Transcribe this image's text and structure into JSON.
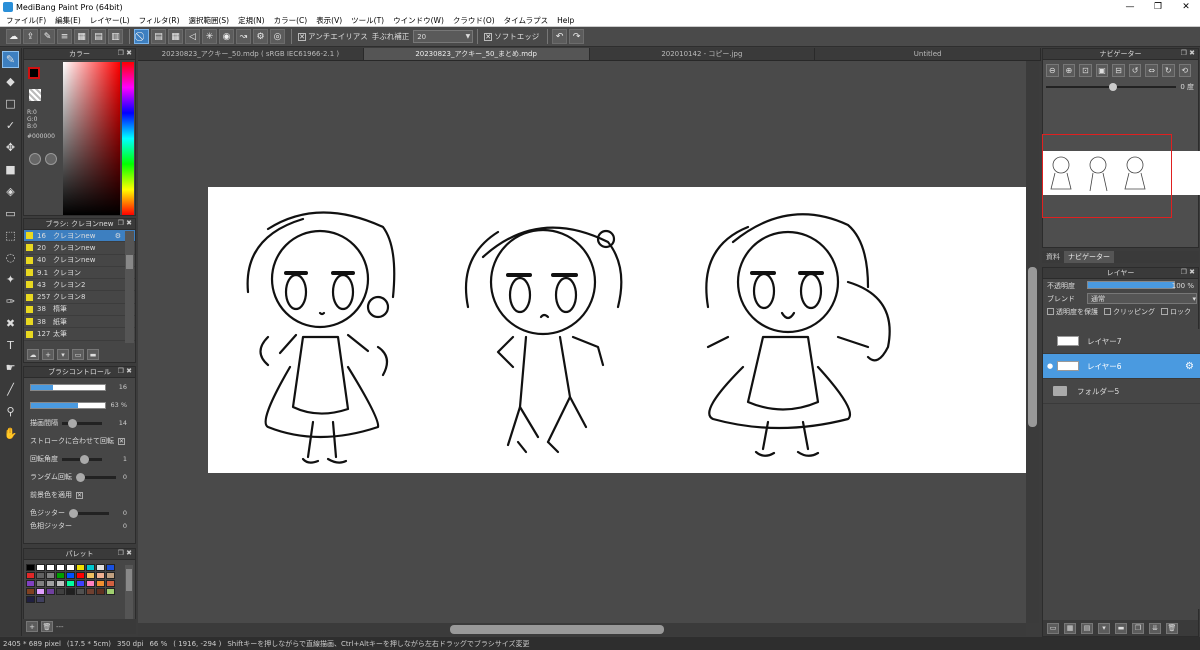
{
  "window": {
    "title": "MediBang Paint Pro (64bit)",
    "minimize": "—",
    "maximize": "❐",
    "close": "✕"
  },
  "menu": [
    "ファイル(F)",
    "編集(E)",
    "レイヤー(L)",
    "フィルタ(R)",
    "選択範囲(S)",
    "定規(N)",
    "カラー(C)",
    "表示(V)",
    "ツール(T)",
    "ウインドウ(W)",
    "クラウド(O)",
    "タイムラプス",
    "Help"
  ],
  "toolbar": {
    "antialias_label": "アンチエイリアス",
    "stabilizer_label": "手ぶれ補正",
    "stabilizer_value": "20",
    "soft_edge_label": "ソフトエッジ"
  },
  "color_panel": {
    "title": "カラー",
    "r": "R:0",
    "g": "G:0",
    "b": "B:0",
    "hex": "#000000"
  },
  "brush_panel": {
    "title": "ブラシ: クレヨンnew",
    "items": [
      {
        "size": "16",
        "name": "クレヨンnew"
      },
      {
        "size": "20",
        "name": "クレヨンnew"
      },
      {
        "size": "40",
        "name": "クレヨンnew"
      },
      {
        "size": "9.1",
        "name": "クレヨン"
      },
      {
        "size": "43",
        "name": "クレヨン2"
      },
      {
        "size": "257",
        "name": "クレヨン8"
      },
      {
        "size": "38",
        "name": "楕筆"
      },
      {
        "size": "38",
        "name": "紙筆"
      },
      {
        "size": "127",
        "name": "太筆"
      }
    ]
  },
  "brush_control": {
    "title": "ブラシコントロール",
    "size_value": "16",
    "opacity_value": "63 %",
    "spacing_label": "描画間隔",
    "spacing_value": "14",
    "rotate_with_stroke_label": "ストロークに合わせて回転",
    "rotation_label": "回転角度",
    "rotation_value": "1",
    "random_rotation_label": "ランダム回転",
    "random_rotation_value": "0",
    "apply_fg_label": "前景色を適用",
    "color_jitter_label": "色ジッター",
    "color_jitter_value": "0",
    "hue_jitter_label": "色相ジッター",
    "hue_jitter_value": "0"
  },
  "palette": {
    "title": "パレット",
    "colors": [
      "#000000",
      "#ffffff",
      "#ffffff",
      "#ffffff",
      "#ffffff",
      "#f0e000",
      "#00c8d0",
      "#e0e0e0",
      "#1850e0",
      "#e02828",
      "#606060",
      "#808080",
      "#00a000",
      "#0050ff",
      "#ff0000",
      "#f0c060",
      "#f0b090",
      "#c0a080",
      "#8040c0",
      "#808080",
      "#a0a0a0",
      "#c0c0c0",
      "#00ffa0",
      "#4040ff",
      "#ff80c0",
      "#f09030",
      "#d06040",
      "#804020",
      "#e0a0ff",
      "#7040a0",
      "#404040",
      "#202020",
      "#505050",
      "#704030",
      "#603020",
      "#a0d070",
      "#202040",
      "#404060"
    ],
    "footer_text": "---"
  },
  "tabs": [
    {
      "label": "20230823_アクキー_50.mdp ( sRGB IEC61966-2.1 )"
    },
    {
      "label": "20230823_アクキー_50_まとめ.mdp"
    },
    {
      "label": "202010142 - コピー.jpg"
    },
    {
      "label": "Untitled"
    }
  ],
  "status": {
    "size": "2405 * 689 pixel",
    "physical": "(17.5 * 5cm)",
    "dpi": "350 dpi",
    "zoom": "66 %",
    "coords": "( 1916, -294 )",
    "hint": "Shiftキーを押しながらで直線描画、Ctrl+Altキーを押しながら左右ドラッグでブラシサイズ変更"
  },
  "navigator": {
    "title": "ナビゲーター",
    "rotation": "0 度"
  },
  "resource_tabs": [
    "資料",
    "ナビゲーター"
  ],
  "layer_panel": {
    "title": "レイヤー",
    "opacity_label": "不透明度",
    "opacity_value": "100 %",
    "blend_label": "ブレンド",
    "blend_value": "通常",
    "protect_alpha_label": "透明度を保護",
    "clipping_label": "クリッピング",
    "lock_label": "ロック",
    "layers": [
      {
        "name": "レイヤー7"
      },
      {
        "name": "レイヤー6"
      },
      {
        "name": "フォルダー5"
      }
    ]
  }
}
